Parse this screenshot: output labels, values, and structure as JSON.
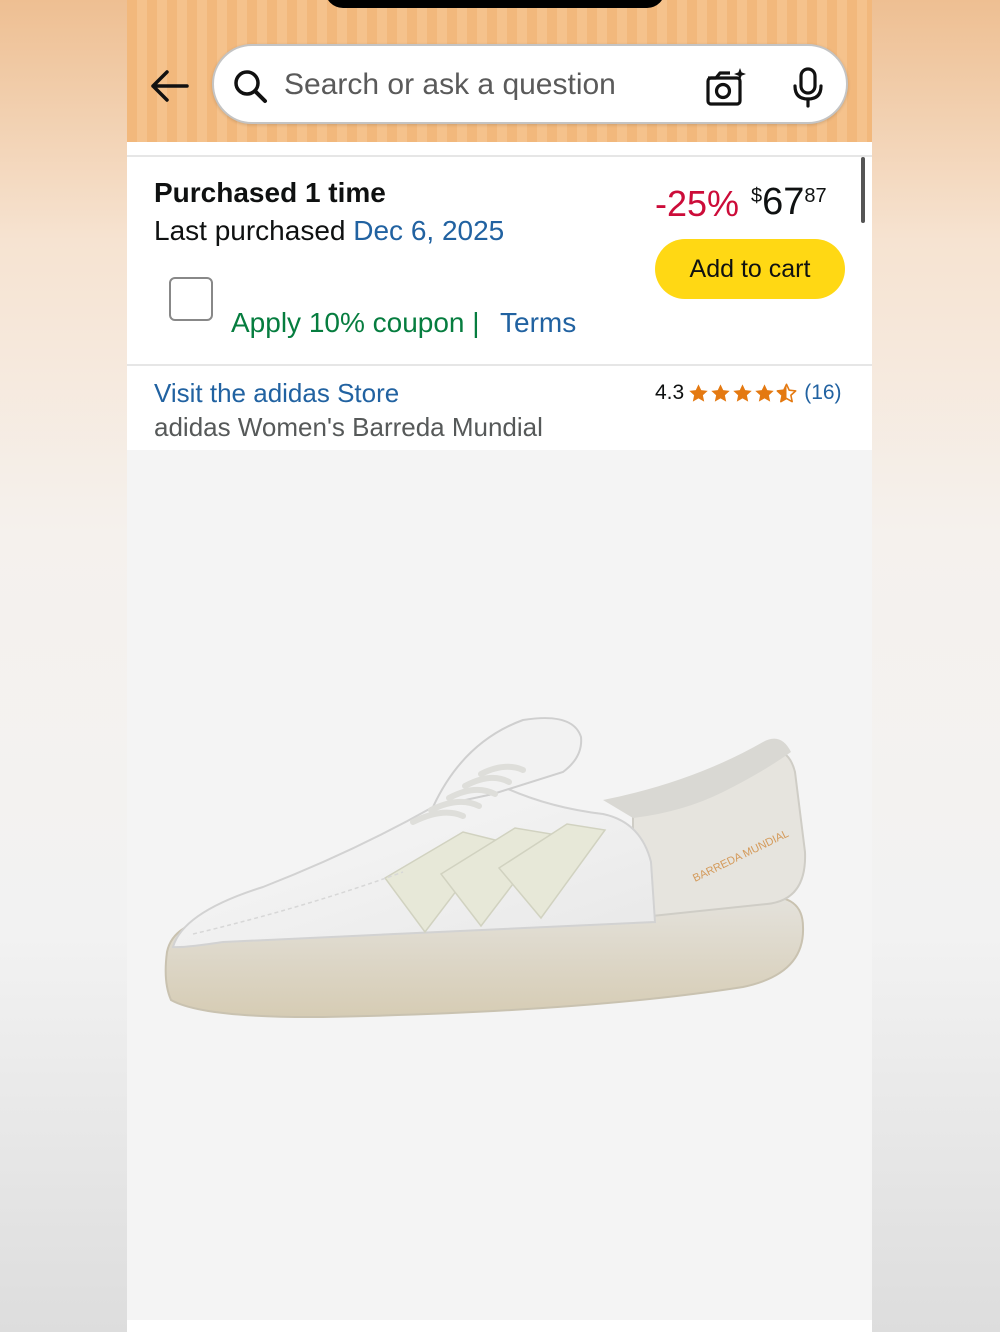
{
  "search": {
    "placeholder": "Search or ask a question"
  },
  "purchase": {
    "title": "Purchased 1 time",
    "last_label": "Last purchased ",
    "last_date": "Dec 6, 2025",
    "coupon_text": "Apply 10% coupon |",
    "terms_label": "Terms"
  },
  "pricing": {
    "discount": "-25%",
    "currency": "$",
    "whole": "67",
    "fraction": "87",
    "add_to_cart_label": "Add to cart"
  },
  "product": {
    "store_link": "Visit the adidas Store",
    "title": "adidas Women's Barreda Mundial",
    "rating": "4.3",
    "rating_value": 4.3,
    "rating_max": 5,
    "review_count": "(16)",
    "shoe_text": "BARREDA MUNDIAL"
  },
  "icons": {
    "back": "arrow-left-icon",
    "search": "search-icon",
    "camera": "camera-lens-icon",
    "mic": "microphone-icon",
    "star": "star-icon"
  },
  "colors": {
    "header": "#f2b87c",
    "discount": "#cc0c39",
    "link": "#2162a1",
    "coupon": "#067d3f",
    "cart_button": "#ffd814",
    "star": "#e47911"
  }
}
